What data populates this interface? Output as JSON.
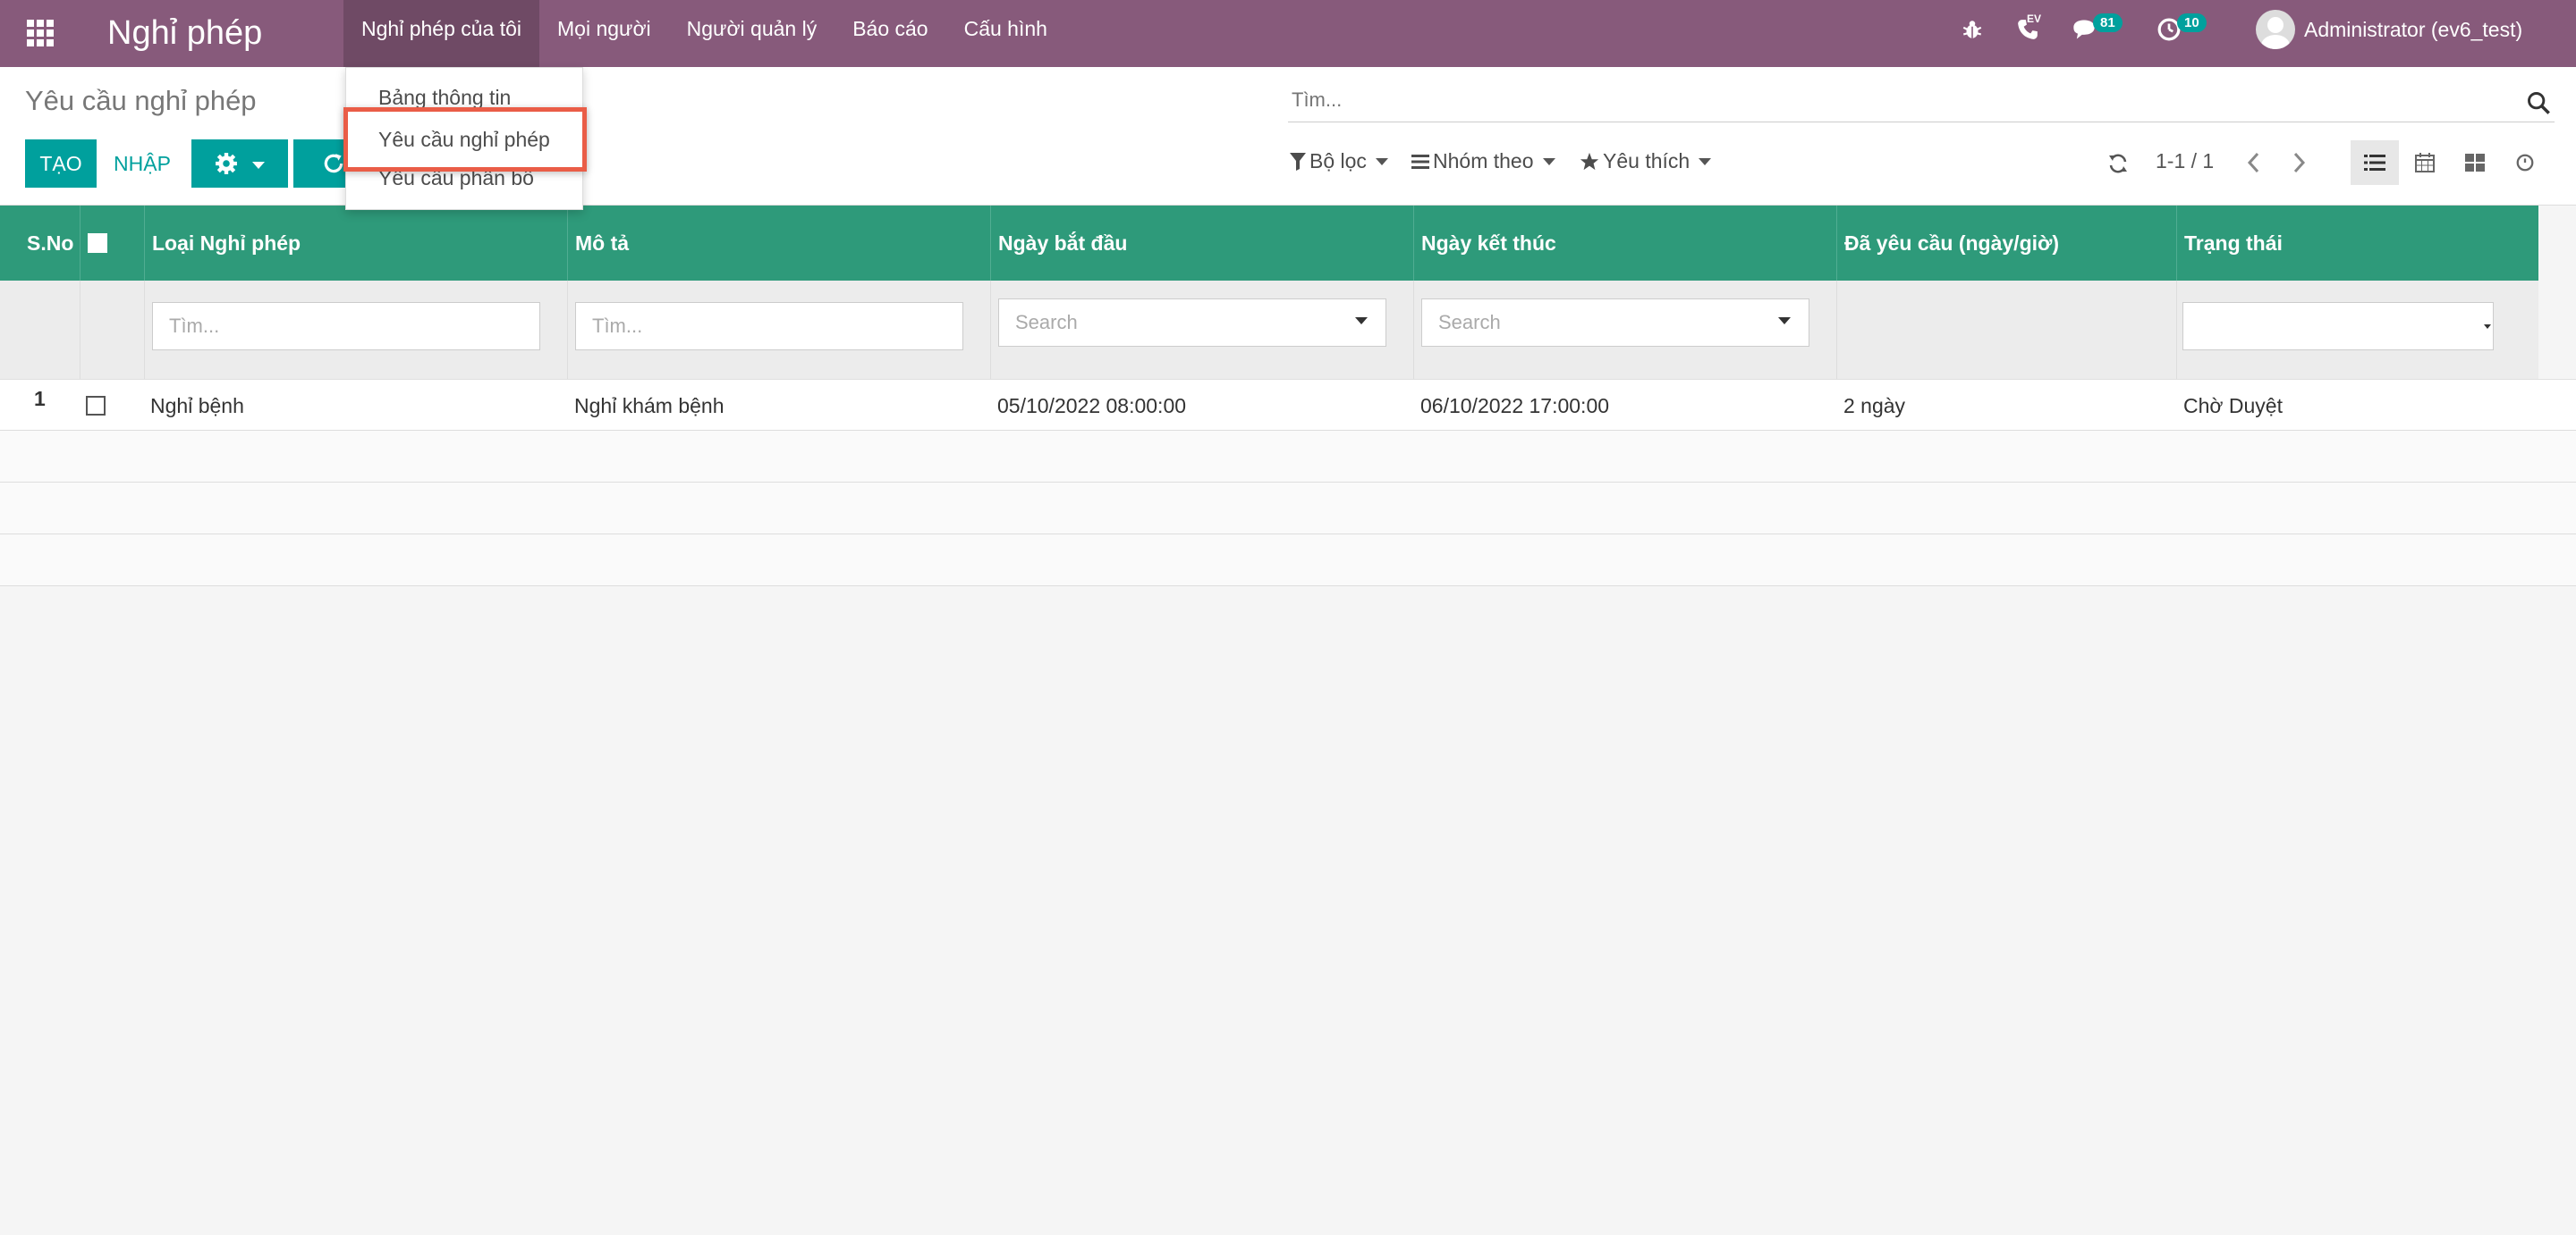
{
  "navbar": {
    "app_title": "Nghỉ phép",
    "menu": [
      "Nghỉ phép của tôi",
      "Mọi người",
      "Người quản lý",
      "Báo cáo",
      "Cấu hình"
    ],
    "phone_label": "EV",
    "messages_count": "81",
    "activities_count": "10",
    "user_name": "Administrator (ev6_test)"
  },
  "dropdown": {
    "items": [
      "Bảng thông tin",
      "Yêu cầu nghỉ phép",
      "Yêu cầu phân bổ"
    ]
  },
  "control_panel": {
    "breadcrumb": "Yêu cầu nghỉ phép",
    "create_label": "TẠO",
    "import_label": "NHẬP",
    "search_placeholder": "Tìm...",
    "filters_label": "Bộ lọc",
    "group_by_label": "Nhóm theo",
    "favorites_label": "Yêu thích",
    "pager": "1-1 / 1"
  },
  "table": {
    "headers": [
      "S.No",
      "Loại Nghỉ phép",
      "Mô tả",
      "Ngày bắt đầu",
      "Ngày kết thúc",
      "Đã yêu cầu (ngày/giờ)",
      "Trạng thái"
    ],
    "filter_placeholders": {
      "leave_type": "Tìm...",
      "description": "Tìm...",
      "date_from": "Search",
      "date_to": "Search"
    },
    "rows": [
      {
        "sno": "1",
        "leave_type": "Nghỉ bệnh",
        "description": "Nghỉ khám bệnh",
        "date_from": "05/10/2022 08:00:00",
        "date_to": "06/10/2022 17:00:00",
        "duration": "2 ngày",
        "state": "Chờ Duyệt"
      }
    ]
  },
  "colors": {
    "navbar": "#875a7b",
    "primary": "#00a09d",
    "table_header": "#2e9a7a",
    "highlight": "#ea5d47"
  }
}
